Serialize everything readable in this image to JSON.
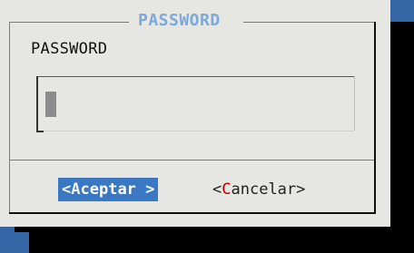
{
  "dialog": {
    "title": "PASSWORD",
    "prompt": "PASSWORD",
    "password_value": ""
  },
  "buttons": {
    "ok": {
      "open": "<",
      "hotkey": "A",
      "rest": "ceptar",
      "close": " >"
    },
    "cancel": {
      "open": "<",
      "hotkey": "C",
      "rest": "ancelar",
      "close": ">"
    }
  },
  "colors": {
    "terminal_blue": "#3465a4",
    "dialog_bg": "#e6e6e3",
    "title": "#7aa9dc",
    "selected_button_bg": "#3a78c3",
    "hotkey_red": "#c40000"
  }
}
